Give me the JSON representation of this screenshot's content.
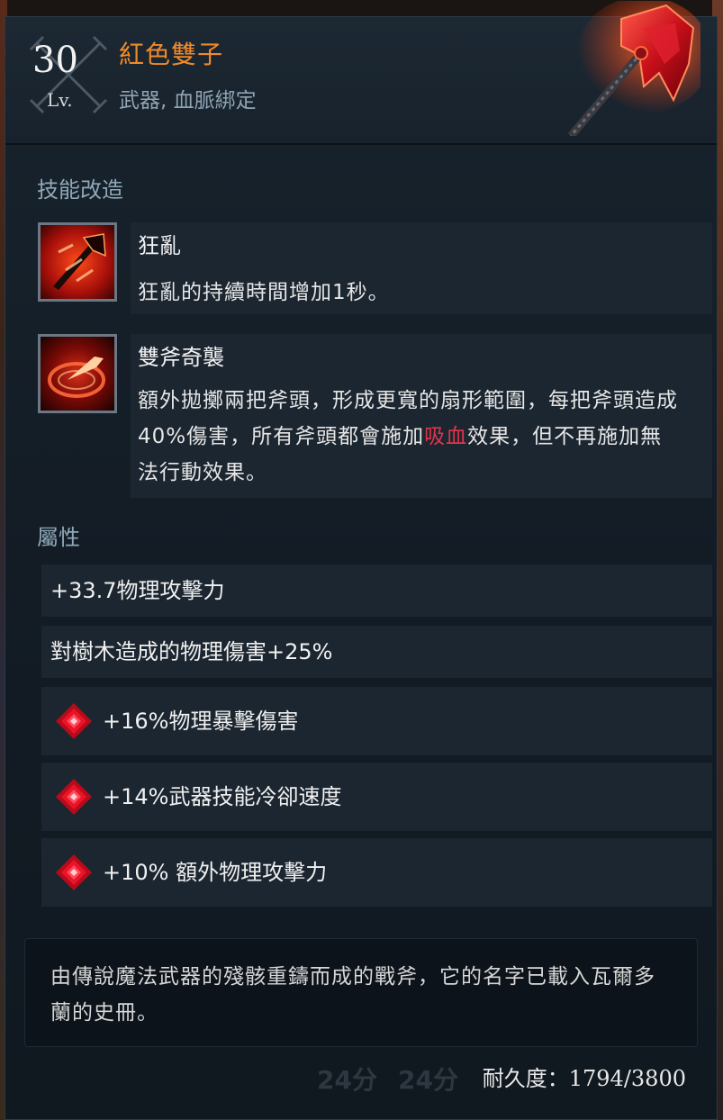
{
  "item": {
    "level_number": "30",
    "level_label": "Lv.",
    "name": "紅色雙子",
    "type": "武器, 血脈綁定",
    "name_color": "#f08a2a"
  },
  "skill_section": {
    "title": "技能改造",
    "skills": [
      {
        "icon": "frenzy-axe-icon",
        "name": "狂亂",
        "description": "狂亂的持續時間增加1秒。"
      },
      {
        "icon": "twin-axe-strike-icon",
        "name": "雙斧奇襲",
        "description_parts": [
          "額外拋擲兩把斧頭，形成更寬的扇形範圍，每把斧頭造成40%傷害，所有斧頭都會施加",
          "吸血",
          "效果，但不再施加無法行動效果。"
        ],
        "highlight_color": "#e0344a"
      }
    ]
  },
  "attributes_section": {
    "title": "屬性",
    "rows": [
      {
        "text": "+33.7物理攻擊力",
        "gem": false
      },
      {
        "text": "對樹木造成的物理傷害+25%",
        "gem": false
      },
      {
        "text": "+16%物理暴擊傷害",
        "gem": true,
        "icon": "red-gem-icon"
      },
      {
        "text": "+14%武器技能冷卻速度",
        "gem": true,
        "icon": "red-gem-icon"
      },
      {
        "text": "+10% 額外物理攻擊力",
        "gem": true,
        "icon": "red-gem-icon"
      }
    ]
  },
  "lore": "由傳說魔法武器的殘骸重鑄而成的戰斧，它的名字已載入瓦爾多蘭的史冊。",
  "background_text": [
    "24分",
    "24分"
  ],
  "durability": {
    "label": "耐久度：",
    "value": "1794/3800"
  }
}
